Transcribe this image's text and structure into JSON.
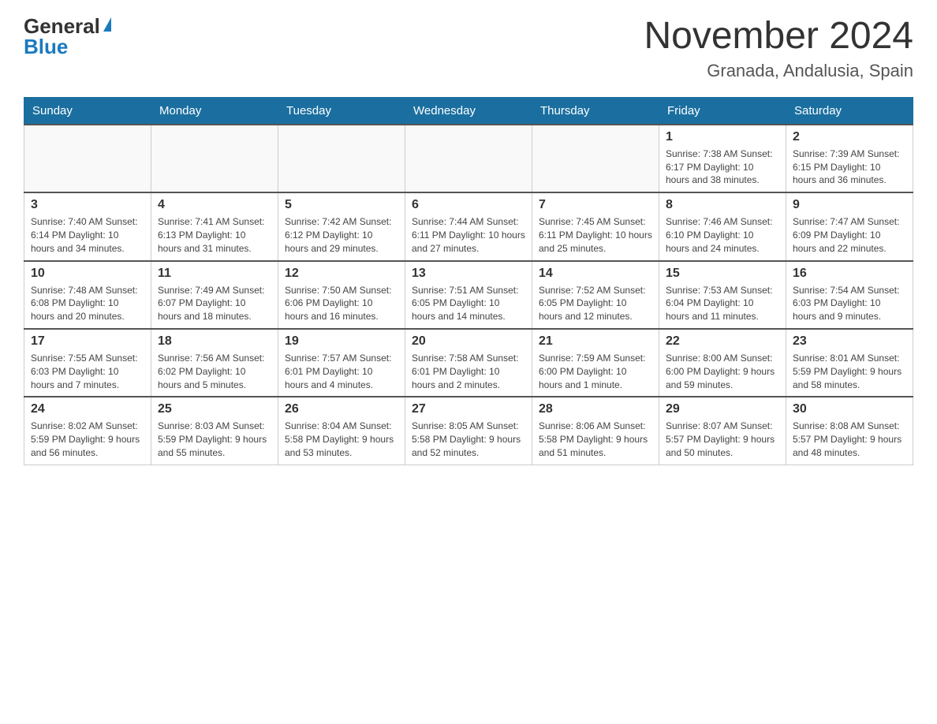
{
  "logo": {
    "general": "General",
    "blue": "Blue"
  },
  "title": "November 2024",
  "location": "Granada, Andalusia, Spain",
  "days_of_week": [
    "Sunday",
    "Monday",
    "Tuesday",
    "Wednesday",
    "Thursday",
    "Friday",
    "Saturday"
  ],
  "weeks": [
    [
      {
        "day": "",
        "info": ""
      },
      {
        "day": "",
        "info": ""
      },
      {
        "day": "",
        "info": ""
      },
      {
        "day": "",
        "info": ""
      },
      {
        "day": "",
        "info": ""
      },
      {
        "day": "1",
        "info": "Sunrise: 7:38 AM\nSunset: 6:17 PM\nDaylight: 10 hours and 38 minutes."
      },
      {
        "day": "2",
        "info": "Sunrise: 7:39 AM\nSunset: 6:15 PM\nDaylight: 10 hours and 36 minutes."
      }
    ],
    [
      {
        "day": "3",
        "info": "Sunrise: 7:40 AM\nSunset: 6:14 PM\nDaylight: 10 hours and 34 minutes."
      },
      {
        "day": "4",
        "info": "Sunrise: 7:41 AM\nSunset: 6:13 PM\nDaylight: 10 hours and 31 minutes."
      },
      {
        "day": "5",
        "info": "Sunrise: 7:42 AM\nSunset: 6:12 PM\nDaylight: 10 hours and 29 minutes."
      },
      {
        "day": "6",
        "info": "Sunrise: 7:44 AM\nSunset: 6:11 PM\nDaylight: 10 hours and 27 minutes."
      },
      {
        "day": "7",
        "info": "Sunrise: 7:45 AM\nSunset: 6:11 PM\nDaylight: 10 hours and 25 minutes."
      },
      {
        "day": "8",
        "info": "Sunrise: 7:46 AM\nSunset: 6:10 PM\nDaylight: 10 hours and 24 minutes."
      },
      {
        "day": "9",
        "info": "Sunrise: 7:47 AM\nSunset: 6:09 PM\nDaylight: 10 hours and 22 minutes."
      }
    ],
    [
      {
        "day": "10",
        "info": "Sunrise: 7:48 AM\nSunset: 6:08 PM\nDaylight: 10 hours and 20 minutes."
      },
      {
        "day": "11",
        "info": "Sunrise: 7:49 AM\nSunset: 6:07 PM\nDaylight: 10 hours and 18 minutes."
      },
      {
        "day": "12",
        "info": "Sunrise: 7:50 AM\nSunset: 6:06 PM\nDaylight: 10 hours and 16 minutes."
      },
      {
        "day": "13",
        "info": "Sunrise: 7:51 AM\nSunset: 6:05 PM\nDaylight: 10 hours and 14 minutes."
      },
      {
        "day": "14",
        "info": "Sunrise: 7:52 AM\nSunset: 6:05 PM\nDaylight: 10 hours and 12 minutes."
      },
      {
        "day": "15",
        "info": "Sunrise: 7:53 AM\nSunset: 6:04 PM\nDaylight: 10 hours and 11 minutes."
      },
      {
        "day": "16",
        "info": "Sunrise: 7:54 AM\nSunset: 6:03 PM\nDaylight: 10 hours and 9 minutes."
      }
    ],
    [
      {
        "day": "17",
        "info": "Sunrise: 7:55 AM\nSunset: 6:03 PM\nDaylight: 10 hours and 7 minutes."
      },
      {
        "day": "18",
        "info": "Sunrise: 7:56 AM\nSunset: 6:02 PM\nDaylight: 10 hours and 5 minutes."
      },
      {
        "day": "19",
        "info": "Sunrise: 7:57 AM\nSunset: 6:01 PM\nDaylight: 10 hours and 4 minutes."
      },
      {
        "day": "20",
        "info": "Sunrise: 7:58 AM\nSunset: 6:01 PM\nDaylight: 10 hours and 2 minutes."
      },
      {
        "day": "21",
        "info": "Sunrise: 7:59 AM\nSunset: 6:00 PM\nDaylight: 10 hours and 1 minute."
      },
      {
        "day": "22",
        "info": "Sunrise: 8:00 AM\nSunset: 6:00 PM\nDaylight: 9 hours and 59 minutes."
      },
      {
        "day": "23",
        "info": "Sunrise: 8:01 AM\nSunset: 5:59 PM\nDaylight: 9 hours and 58 minutes."
      }
    ],
    [
      {
        "day": "24",
        "info": "Sunrise: 8:02 AM\nSunset: 5:59 PM\nDaylight: 9 hours and 56 minutes."
      },
      {
        "day": "25",
        "info": "Sunrise: 8:03 AM\nSunset: 5:59 PM\nDaylight: 9 hours and 55 minutes."
      },
      {
        "day": "26",
        "info": "Sunrise: 8:04 AM\nSunset: 5:58 PM\nDaylight: 9 hours and 53 minutes."
      },
      {
        "day": "27",
        "info": "Sunrise: 8:05 AM\nSunset: 5:58 PM\nDaylight: 9 hours and 52 minutes."
      },
      {
        "day": "28",
        "info": "Sunrise: 8:06 AM\nSunset: 5:58 PM\nDaylight: 9 hours and 51 minutes."
      },
      {
        "day": "29",
        "info": "Sunrise: 8:07 AM\nSunset: 5:57 PM\nDaylight: 9 hours and 50 minutes."
      },
      {
        "day": "30",
        "info": "Sunrise: 8:08 AM\nSunset: 5:57 PM\nDaylight: 9 hours and 48 minutes."
      }
    ]
  ]
}
